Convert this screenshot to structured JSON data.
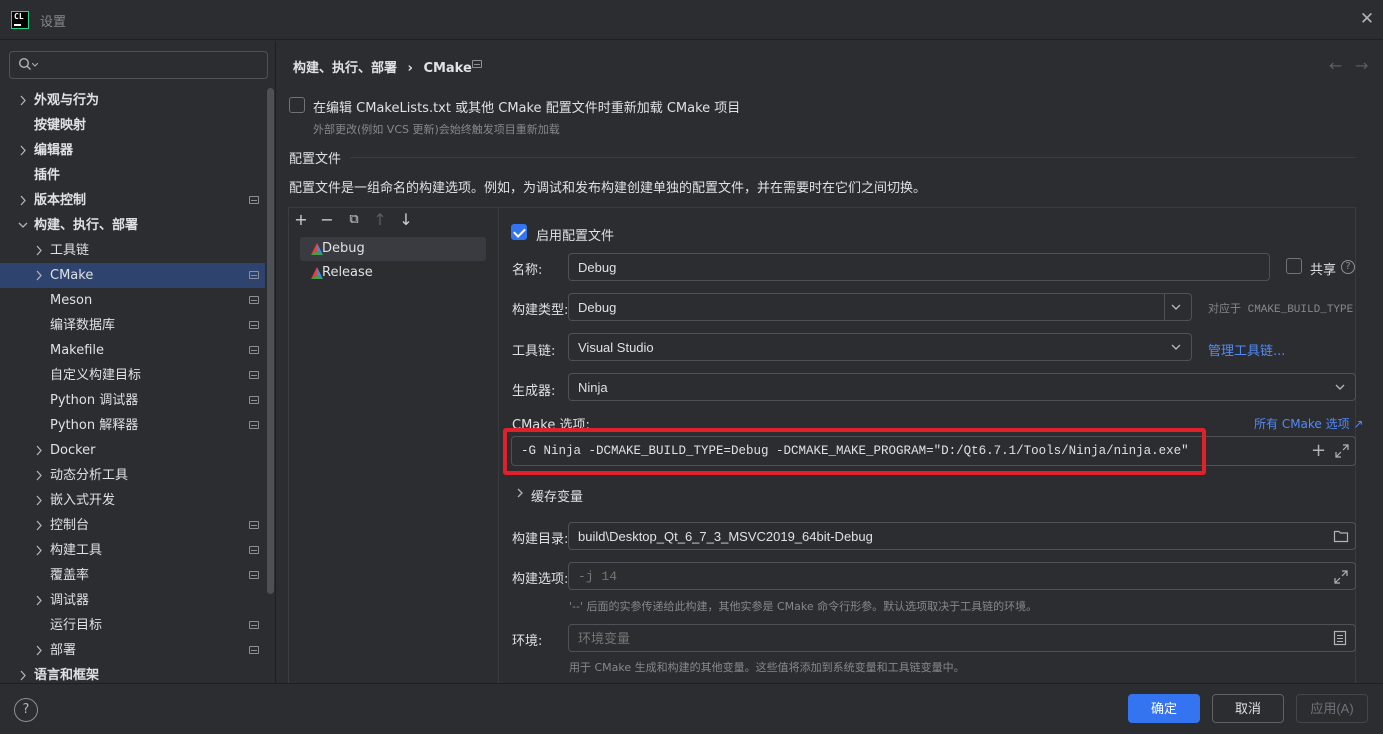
{
  "window": {
    "title": "设置",
    "logo_text": "CL"
  },
  "search": {
    "placeholder": ""
  },
  "sidebar": {
    "items": [
      {
        "label": "外观与行为",
        "chevron": true,
        "bold": true,
        "level": 0,
        "proj": false
      },
      {
        "label": "按键映射",
        "chevron": false,
        "bold": true,
        "level": 0,
        "proj": false
      },
      {
        "label": "编辑器",
        "chevron": true,
        "bold": true,
        "level": 0,
        "proj": false
      },
      {
        "label": "插件",
        "chevron": false,
        "bold": true,
        "level": 0,
        "proj": false
      },
      {
        "label": "版本控制",
        "chevron": true,
        "bold": true,
        "level": 0,
        "proj": true
      },
      {
        "label": "构建、执行、部署",
        "chevron": true,
        "expanded": true,
        "bold": true,
        "level": 0,
        "proj": false
      },
      {
        "label": "工具链",
        "chevron": true,
        "bold": false,
        "level": 1,
        "proj": false
      },
      {
        "label": "CMake",
        "chevron": true,
        "bold": false,
        "level": 1,
        "proj": true,
        "selected": true
      },
      {
        "label": "Meson",
        "chevron": false,
        "bold": false,
        "level": 1,
        "proj": true
      },
      {
        "label": "编译数据库",
        "chevron": false,
        "bold": false,
        "level": 1,
        "proj": true
      },
      {
        "label": "Makefile",
        "chevron": false,
        "bold": false,
        "level": 1,
        "proj": true
      },
      {
        "label": "自定义构建目标",
        "chevron": false,
        "bold": false,
        "level": 1,
        "proj": true
      },
      {
        "label": "Python 调试器",
        "chevron": false,
        "bold": false,
        "level": 1,
        "proj": true
      },
      {
        "label": "Python 解释器",
        "chevron": false,
        "bold": false,
        "level": 1,
        "proj": true
      },
      {
        "label": "Docker",
        "chevron": true,
        "bold": false,
        "level": 1,
        "proj": false
      },
      {
        "label": "动态分析工具",
        "chevron": true,
        "bold": false,
        "level": 1,
        "proj": false
      },
      {
        "label": "嵌入式开发",
        "chevron": true,
        "bold": false,
        "level": 1,
        "proj": false
      },
      {
        "label": "控制台",
        "chevron": true,
        "bold": false,
        "level": 1,
        "proj": true
      },
      {
        "label": "构建工具",
        "chevron": true,
        "bold": false,
        "level": 1,
        "proj": true
      },
      {
        "label": "覆盖率",
        "chevron": false,
        "bold": false,
        "level": 1,
        "proj": true
      },
      {
        "label": "调试器",
        "chevron": true,
        "bold": false,
        "level": 1,
        "proj": false
      },
      {
        "label": "运行目标",
        "chevron": false,
        "bold": false,
        "level": 1,
        "proj": true
      },
      {
        "label": "部署",
        "chevron": true,
        "bold": false,
        "level": 1,
        "proj": true
      },
      {
        "label": "语言和框架",
        "chevron": true,
        "bold": true,
        "level": 0,
        "proj": false
      }
    ]
  },
  "header": {
    "breadcrumb_parent": "构建、执行、部署",
    "breadcrumb_sep": "›",
    "breadcrumb_current": "CMake",
    "back": "←",
    "forward": "→"
  },
  "reload": {
    "label": "在编辑 CMakeLists.txt 或其他 CMake 配置文件时重新加载 CMake 项目",
    "hint": "外部更改(例如 VCS 更新)会始终触发项目重新加载",
    "checked": false
  },
  "profiles_section": {
    "title": "配置文件",
    "description": "配置文件是一组命名的构建选项。例如，为调试和发布构建创建单独的配置文件，并在需要时在它们之间切换。"
  },
  "toolbar": {
    "add": "+",
    "remove": "−",
    "copy": "⧉",
    "up": "↑",
    "down": "↓"
  },
  "profiles": [
    {
      "name": "Debug",
      "selected": true
    },
    {
      "name": "Release",
      "selected": false
    }
  ],
  "form": {
    "enable_label": "启用配置文件",
    "enable_checked": true,
    "name_label": "名称:",
    "name_value": "Debug",
    "share_label": "共享",
    "share_help": "?",
    "build_type_label": "构建类型:",
    "build_type_value": "Debug",
    "build_type_hint": "对应于 CMAKE_BUILD_TYPE",
    "toolchain_label": "工具链:",
    "toolchain_value": "Visual Studio",
    "toolchain_link": "管理工具链...",
    "generator_label": "生成器:",
    "generator_value": "Ninja",
    "cmake_options_label": "CMake 选项:",
    "cmake_options_link": "所有 CMake 选项 ↗",
    "cmake_options_value": "-G Ninja -DCMAKE_BUILD_TYPE=Debug -DCMAKE_MAKE_PROGRAM=\"D:/Qt6.7.1/Tools/Ninja/ninja.exe\"",
    "cache_vars_label": "缓存变量",
    "build_dir_label": "构建目录:",
    "build_dir_value": "build\\Desktop_Qt_6_7_3_MSVC2019_64bit-Debug",
    "build_opts_label": "构建选项:",
    "build_opts_placeholder": "-j 14",
    "build_opts_hint": "'--' 后面的实参传递给此构建，其他实参是 CMake 命令行形参。默认选项取决于工具链的环境。",
    "env_label": "环境:",
    "env_placeholder": "环境变量",
    "env_hint": "用于 CMake 生成和构建的其他变量。这些值将添加到系统变量和工具链变量中。"
  },
  "footer": {
    "help": "?",
    "ok": "确定",
    "cancel": "取消",
    "apply": "应用(A)"
  },
  "colors": {
    "accent": "#3574f0",
    "link": "#548af7",
    "highlight_box": "#e0202a",
    "selection": "#2e436e"
  }
}
